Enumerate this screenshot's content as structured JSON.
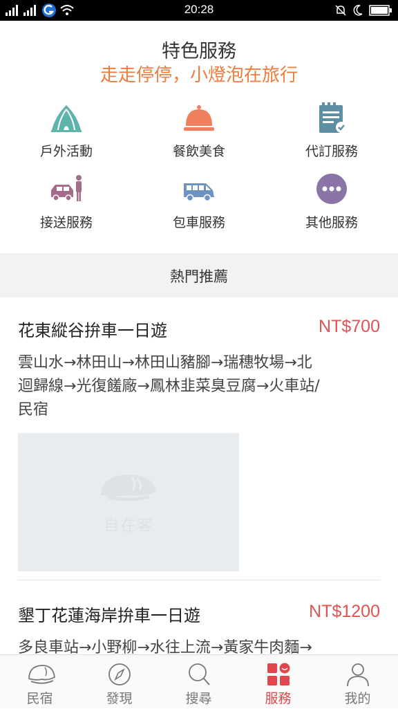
{
  "status_bar": {
    "time": "20:28"
  },
  "header": {
    "title": "特色服務",
    "subtitle": "走走停停，小燈泡在旅行"
  },
  "services": [
    {
      "label": "戶外活動",
      "icon": "tent-icon",
      "color": "#5fb3ad"
    },
    {
      "label": "餐飲美食",
      "icon": "food-cloche-icon",
      "color": "#ef7f5f"
    },
    {
      "label": "代訂服務",
      "icon": "checklist-icon",
      "color": "#5b8fa1"
    },
    {
      "label": "接送服務",
      "icon": "car-person-icon",
      "color": "#a46b8a"
    },
    {
      "label": "包車服務",
      "icon": "van-icon",
      "color": "#6e92c2"
    },
    {
      "label": "其他服務",
      "icon": "more-icon",
      "color": "#8c74a6"
    }
  ],
  "hot": {
    "label": "熱門推薦"
  },
  "tours": [
    {
      "title": "花東縱谷拚車一日遊",
      "price": "NT$700",
      "route_line1": "雲山水→林田山→林田山豬腳→瑞穗牧場→北",
      "route_line2": "迴歸線→光復饈廠→鳳林韭菜臭豆腐→火車站/",
      "route_line3": "民宿",
      "photo_watermark": "自在客"
    },
    {
      "title": "墾丁花蓮海岸拚車一日遊",
      "price": "NT$1200",
      "route_line1": "多良車站→小野柳→水往上流→黃家牛肉麵→"
    }
  ],
  "tabbar": [
    {
      "label": "民宿",
      "icon": "homestay-icon",
      "active": false
    },
    {
      "label": "發現",
      "icon": "compass-icon",
      "active": false
    },
    {
      "label": "搜尋",
      "icon": "search-icon",
      "active": false
    },
    {
      "label": "服務",
      "icon": "service-icon",
      "active": true
    },
    {
      "label": "我的",
      "icon": "user-icon",
      "active": false
    }
  ],
  "colors": {
    "accent_red": "#e0474c",
    "orange": "#ef7b3c",
    "price_red": "#e05353"
  }
}
